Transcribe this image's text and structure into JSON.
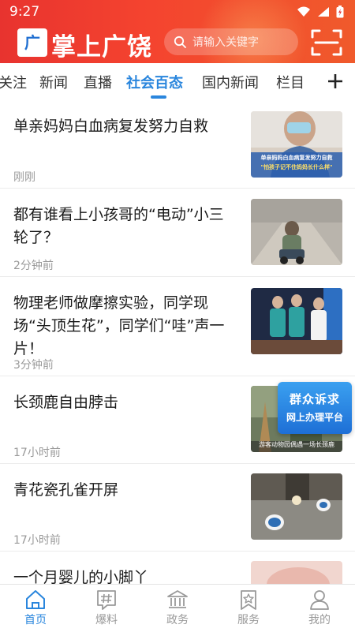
{
  "status_bar": {
    "time": "9:27"
  },
  "header": {
    "logo_text": "广饶",
    "app_title": "掌上广饶",
    "search_placeholder": "请输入关键字"
  },
  "tabs": [
    {
      "label": "关注",
      "active": false
    },
    {
      "label": "新闻",
      "active": false
    },
    {
      "label": "直播",
      "active": false
    },
    {
      "label": "社会百态",
      "active": true
    },
    {
      "label": "国内新闻",
      "active": false
    },
    {
      "label": "栏目",
      "active": false
    }
  ],
  "tab_add_icon": "plus-icon",
  "feed": [
    {
      "title": "单亲妈妈白血病复发努力自救",
      "time": "刚刚",
      "thumb_caption_1": "单亲妈妈白血病复发努力自救",
      "thumb_caption_2": "\"怕孩子记不住妈妈长什么样\""
    },
    {
      "title": "都有谁看上小孩哥的“电动”小三轮了？",
      "time": "2分钟前"
    },
    {
      "title": "物理老师做摩擦实验，同学现场“头顶生花”，同学们“哇”声一片！",
      "time": "3分钟前"
    },
    {
      "title": "长颈鹿自由脖击",
      "time": "17小时前",
      "thumb_caption": "游客动物园偶遇一场长颈鹿"
    },
    {
      "title": "青花瓷孔雀开屏",
      "time": "17小时前"
    },
    {
      "title": "一个月婴儿的小脚丫",
      "time": ""
    }
  ],
  "float_badge": {
    "line1": "群众诉求",
    "line2": "网上办理平台"
  },
  "bottom_nav": [
    {
      "label": "首页",
      "icon": "home-icon",
      "active": true
    },
    {
      "label": "爆料",
      "icon": "hashtag-icon",
      "active": false
    },
    {
      "label": "政务",
      "icon": "government-building-icon",
      "active": false
    },
    {
      "label": "服务",
      "icon": "service-star-icon",
      "active": false
    },
    {
      "label": "我的",
      "icon": "user-icon",
      "active": false
    }
  ],
  "colors": {
    "header_red": "#e8332f",
    "accent_blue": "#2a86dd",
    "muted_gray": "#9a9a9a"
  }
}
